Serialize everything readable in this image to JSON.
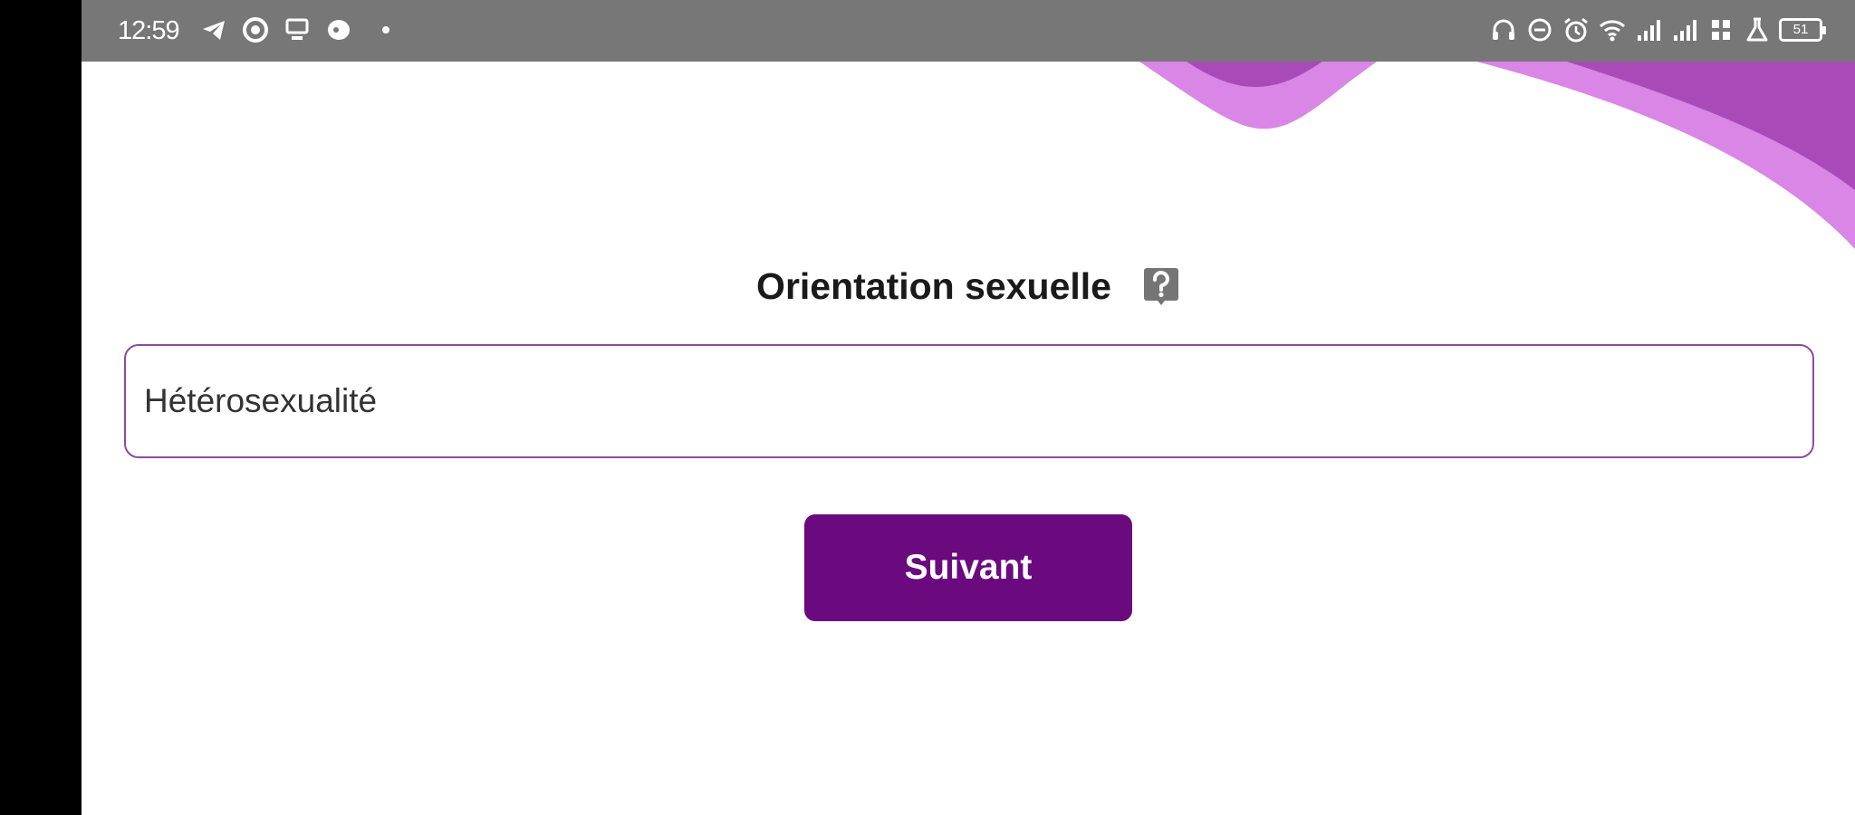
{
  "status_bar": {
    "time": "12:59",
    "battery": "51",
    "left_icons": [
      "telegram-icon",
      "recorder-icon",
      "cast-icon",
      "app-icon"
    ],
    "right_icons": [
      "headset-icon",
      "dnd-icon",
      "alarm-icon",
      "wifi-icon",
      "signal-icon",
      "signal-icon",
      "data-speed-icon",
      "flask-icon",
      "battery-icon"
    ]
  },
  "form": {
    "title": "Orientation sexuelle",
    "help_icon": "help-icon",
    "field_value": "Hétérosexualité",
    "next_label": "Suivant"
  },
  "colors": {
    "status_bar": "#777777",
    "accent": "#6a0a7e",
    "wave_light": "#d986e6",
    "wave_dark": "#a84bb8",
    "field_border": "#8e4a9e"
  }
}
